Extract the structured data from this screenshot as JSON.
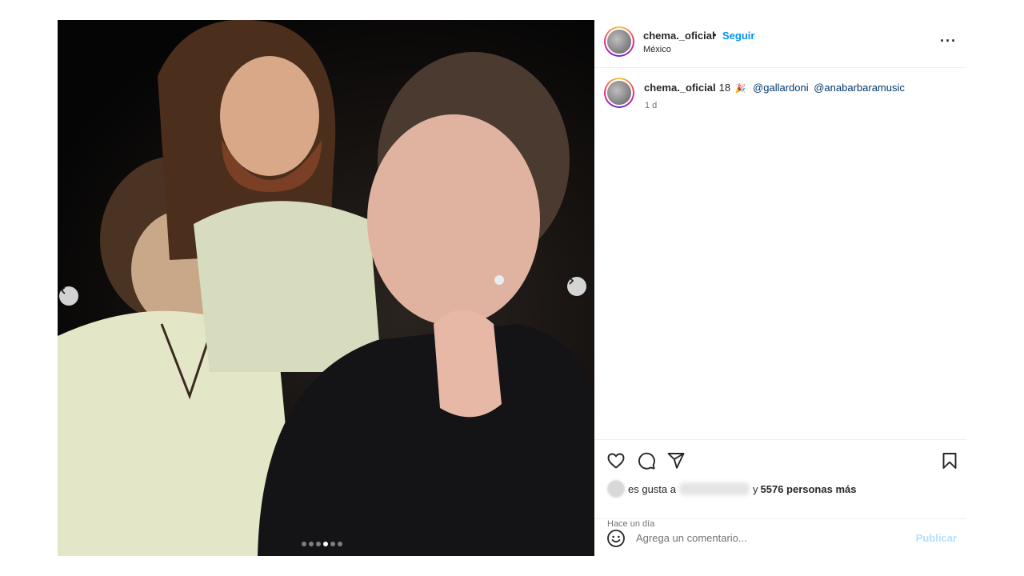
{
  "post": {
    "image_alt": "Selfie de tres personas de noche",
    "carousel": {
      "count": 6,
      "active_index": 3
    }
  },
  "header": {
    "username": "chema._oficial",
    "separator": "•",
    "follow_label": "Seguir",
    "location": "México",
    "more_icon": "more-horizontal-icon"
  },
  "caption": {
    "username": "chema._oficial",
    "text": "18",
    "emoji": "🎉",
    "mentions": [
      "@gallardoni",
      "@anabarbaramusic"
    ],
    "time": "1 d"
  },
  "actions": {
    "icons": [
      "heart-icon",
      "comment-icon",
      "share-icon",
      "bookmark-icon"
    ],
    "likes_prefix": "es gusta a",
    "likes_suffix": "y",
    "likes_count": "5576 personas más",
    "time_full": "Hace un día"
  },
  "comment": {
    "placeholder": "Agrega un comentario...",
    "publish_label": "Publicar"
  },
  "colors": {
    "accent": "#0095f6",
    "mention": "#00376b",
    "publish_disabled": "#b2dffc",
    "text": "#262626",
    "muted": "#737373"
  }
}
